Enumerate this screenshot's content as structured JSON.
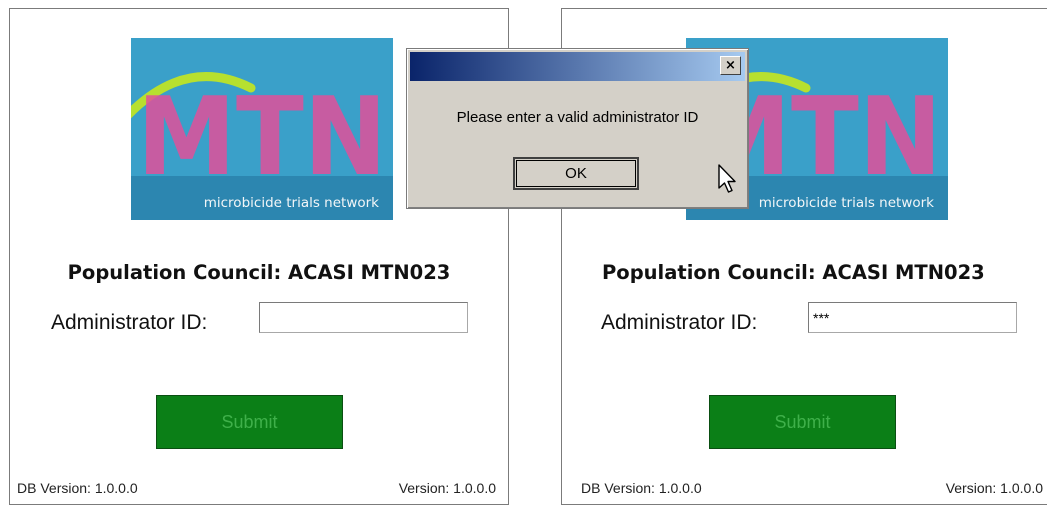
{
  "left_panel": {
    "logo_text": "MTN",
    "logo_subtitle": "microbicide trials network",
    "title": "Population Council: ACASI MTN023",
    "admin_label": "Administrator ID:",
    "admin_value": "",
    "submit_label": "Submit",
    "db_version": "DB Version: 1.0.0.0",
    "version": "Version: 1.0.0.0"
  },
  "right_panel": {
    "logo_text": "MTN",
    "logo_subtitle": "microbicide trials network",
    "title": "Population Council: ACASI MTN023",
    "admin_label": "Administrator ID:",
    "admin_value": "***",
    "submit_label": "Submit",
    "db_version": "DB Version: 1.0.0.0",
    "version": "Version: 1.0.0.0"
  },
  "dialog": {
    "title": "",
    "close_label": "×",
    "message": "Please enter a valid administrator ID",
    "ok_label": "OK"
  },
  "colors": {
    "logo_bg": "#3aa0c9",
    "logo_letters": "#e0509a",
    "arc": "#b7e02f",
    "submit_bg": "#0b7f17",
    "submit_text": "#3fb04a",
    "dialog_bg": "#d4d0c8",
    "titlebar_start": "#0a246a",
    "titlebar_end": "#a6caf0"
  }
}
